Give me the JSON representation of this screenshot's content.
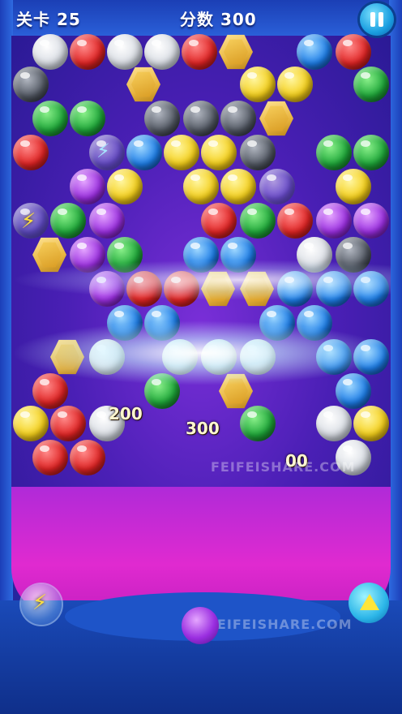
{
  "hud": {
    "level_label": "关卡",
    "level_value": "25",
    "score_label": "分数",
    "score_value": "300"
  },
  "popups": [
    "200",
    "300",
    "00"
  ],
  "watermark": "FEIFEISHARE.COM",
  "colors": {
    "frame_blue": "#1c3fb8",
    "playfield_purple": "#4a1fb5",
    "magenta": "#e02ad0"
  },
  "icons": {
    "pause": "pause-icon",
    "booster_left": "lightning-bolt-icon",
    "booster_right": "triangle-play-icon"
  }
}
